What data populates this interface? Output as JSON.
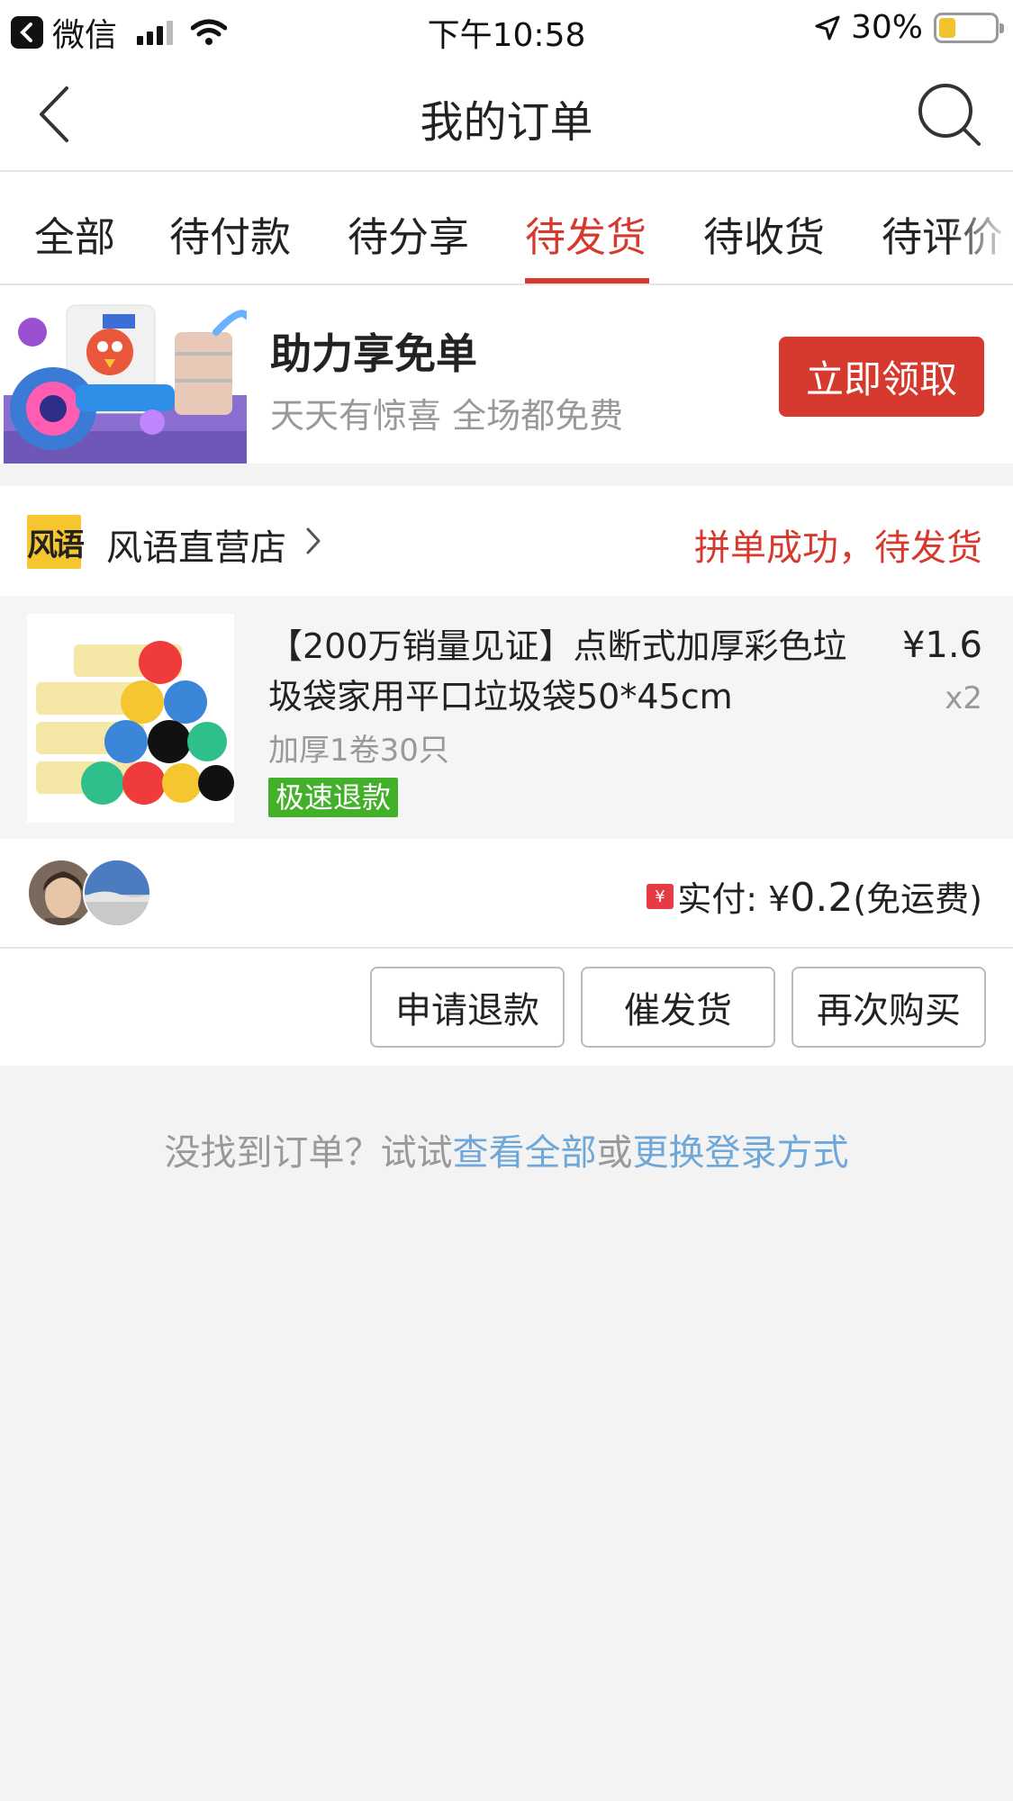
{
  "status_bar": {
    "app_back_label": "微信",
    "time": "下午10:58",
    "battery_percent": "30%",
    "battery_level": 0.3
  },
  "header": {
    "title": "我的订单"
  },
  "tabs": [
    {
      "label": "全部",
      "active": false
    },
    {
      "label": "待付款",
      "active": false
    },
    {
      "label": "待分享",
      "active": false
    },
    {
      "label": "待发货",
      "active": true
    },
    {
      "label": "待收货",
      "active": false
    },
    {
      "label": "待评价",
      "active": false
    }
  ],
  "promo": {
    "title": "助力享免单",
    "subtitle": "天天有惊喜 全场都免费",
    "button": "立即领取"
  },
  "order": {
    "shop_logo_text": "风语",
    "shop_name": "风语直营店",
    "status": "拼单成功，待发货",
    "item_title": "【200万销量见证】点断式加厚彩色垃圾袋家用平口垃圾袋50*45cm",
    "price": "¥1.6",
    "quantity": "x2",
    "spec": "加厚1卷30只",
    "badge": "极速退款",
    "pay_label": "实付: ¥",
    "pay_amount": "0.2",
    "pay_note": "(免运费)",
    "buttons": {
      "refund": "申请退款",
      "urge": "催发货",
      "rebuy": "再次购买"
    }
  },
  "footer": {
    "prefix": "没找到订单？试试",
    "link1": "查看全部",
    "middle": "或",
    "link2": "更换登录方式"
  },
  "colors": {
    "accent": "#d63a2f",
    "badge_green": "#43b02a",
    "link_blue": "#6fa7d9",
    "background": "#f3f3f3"
  },
  "icons": [
    "back-arrow-icon",
    "search-icon",
    "chevron-right-icon",
    "wifi-icon",
    "location-arrow-icon",
    "battery-icon",
    "payment-icon"
  ]
}
